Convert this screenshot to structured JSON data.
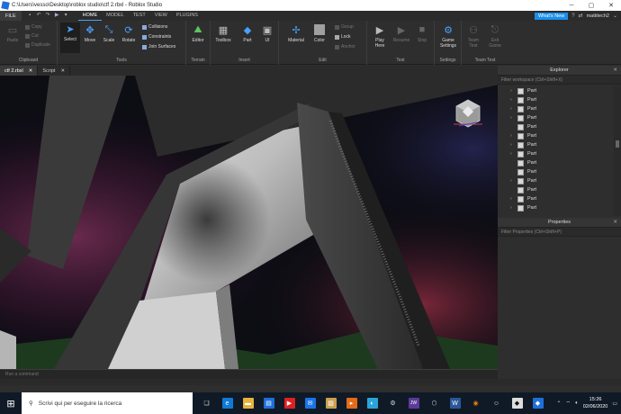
{
  "window": {
    "title": "C:\\Users\\vesso\\Desktop\\roblox studio\\ctf 2.rbxl - Roblox Studio"
  },
  "menubar": {
    "file": "FILE",
    "tabs": [
      "HOME",
      "MODEL",
      "TEST",
      "VIEW",
      "PLUGINS"
    ],
    "whats_new": "What's New",
    "user": "mattitech2"
  },
  "ribbon": {
    "clipboard": {
      "label": "Clipboard",
      "paste": "Paste",
      "copy": "Copy",
      "cut": "Cut",
      "duplicate": "Duplicate"
    },
    "tools": {
      "label": "Tools",
      "select": "Select",
      "move": "Move",
      "scale": "Scale",
      "rotate": "Rotate",
      "collisions": "Collisions",
      "constraints": "Constraints",
      "join_surfaces": "Join Surfaces"
    },
    "terrain": {
      "label": "Terrain",
      "editor": "Editor"
    },
    "insert": {
      "label": "Insert",
      "toolbox": "Toolbox",
      "part": "Part",
      "ui": "UI"
    },
    "edit": {
      "label": "Edit",
      "material": "Material",
      "color": "Color",
      "group": "Group",
      "lock": "Lock",
      "anchor": "Anchor"
    },
    "test": {
      "label": "Test",
      "play": "Play",
      "play_sub": "Here",
      "resume": "Resume",
      "stop": "Stop"
    },
    "settings": {
      "label": "Settings",
      "game_settings": "Game Settings"
    },
    "team_test": {
      "label": "Team Test",
      "team_test": "Team Test",
      "exit_game": "Exit Game"
    }
  },
  "doc_tabs": [
    {
      "label": "ctf 2.rbxl",
      "close": "✕"
    },
    {
      "label": "Script",
      "close": "✕"
    }
  ],
  "command_bar": {
    "placeholder": "Run a command"
  },
  "explorer": {
    "title": "Explorer",
    "filter": "Filter workspace (Ctrl+Shift+X)",
    "items": [
      {
        "label": "Part",
        "expand": true
      },
      {
        "label": "Part",
        "expand": true
      },
      {
        "label": "Part",
        "expand": true
      },
      {
        "label": "Part",
        "expand": true
      },
      {
        "label": "Part",
        "expand": false
      },
      {
        "label": "Part",
        "expand": true
      },
      {
        "label": "Part",
        "expand": true
      },
      {
        "label": "Part",
        "expand": true
      },
      {
        "label": "Part",
        "expand": false
      },
      {
        "label": "Part",
        "expand": false
      },
      {
        "label": "Part",
        "expand": true
      },
      {
        "label": "Part",
        "expand": false
      },
      {
        "label": "Part",
        "expand": true
      },
      {
        "label": "Part",
        "expand": true
      }
    ]
  },
  "properties": {
    "title": "Properties",
    "filter": "Filter Properties (Ctrl+Shift+P)"
  },
  "taskbar": {
    "search_placeholder": "Scrivi qui per eseguire la ricerca",
    "time": "15:26",
    "date": "02/06/2020"
  }
}
